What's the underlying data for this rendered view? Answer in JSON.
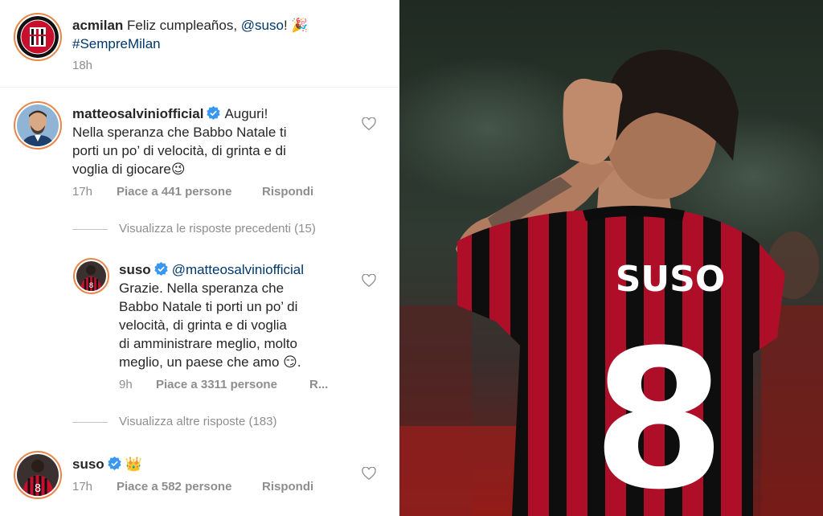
{
  "post": {
    "username": "acmilan",
    "caption_text": "Feliz cumpleaños, ",
    "caption_mention": "@suso",
    "caption_end": "! 🎉",
    "hashtag": "#SempreMilan",
    "time": "18h"
  },
  "comments": [
    {
      "username": "matteosalviniofficial",
      "line1": "Auguri!",
      "lines": [
        "Nella speranza che Babbo Natale ti",
        "porti un po’ di velocità, di grinta e di",
        "voglia di giocare😉"
      ],
      "time": "17h",
      "likes": "Piace a 441 persone",
      "reply": "Rispondi"
    }
  ],
  "view_previous": "Visualizza le risposte precedenti (15)",
  "reply": {
    "username": "suso",
    "mention": "@matteosalviniofficial",
    "lines": [
      "Grazie. Nella speranza che",
      "Babbo Natale ti porti un po’ di",
      "velocità, di grinta e di voglia",
      "di amministrare meglio, molto",
      "meglio, un paese che amo 😏."
    ],
    "time": "9h",
    "likes": "Piace a 3311 persone",
    "reply": "R..."
  },
  "view_more": "Visualizza altre risposte (183)",
  "comment3": {
    "username": "suso",
    "emoji": "👑",
    "time": "17h",
    "likes": "Piace a 582 persone",
    "reply": "Rispondi"
  },
  "photo": {
    "jersey_name": "SUSO",
    "jersey_number": "8"
  },
  "colors": {
    "verified": "#3897f0",
    "mention": "#00376b",
    "meta": "#8e8e8e",
    "story_ring": "#e8864a"
  }
}
